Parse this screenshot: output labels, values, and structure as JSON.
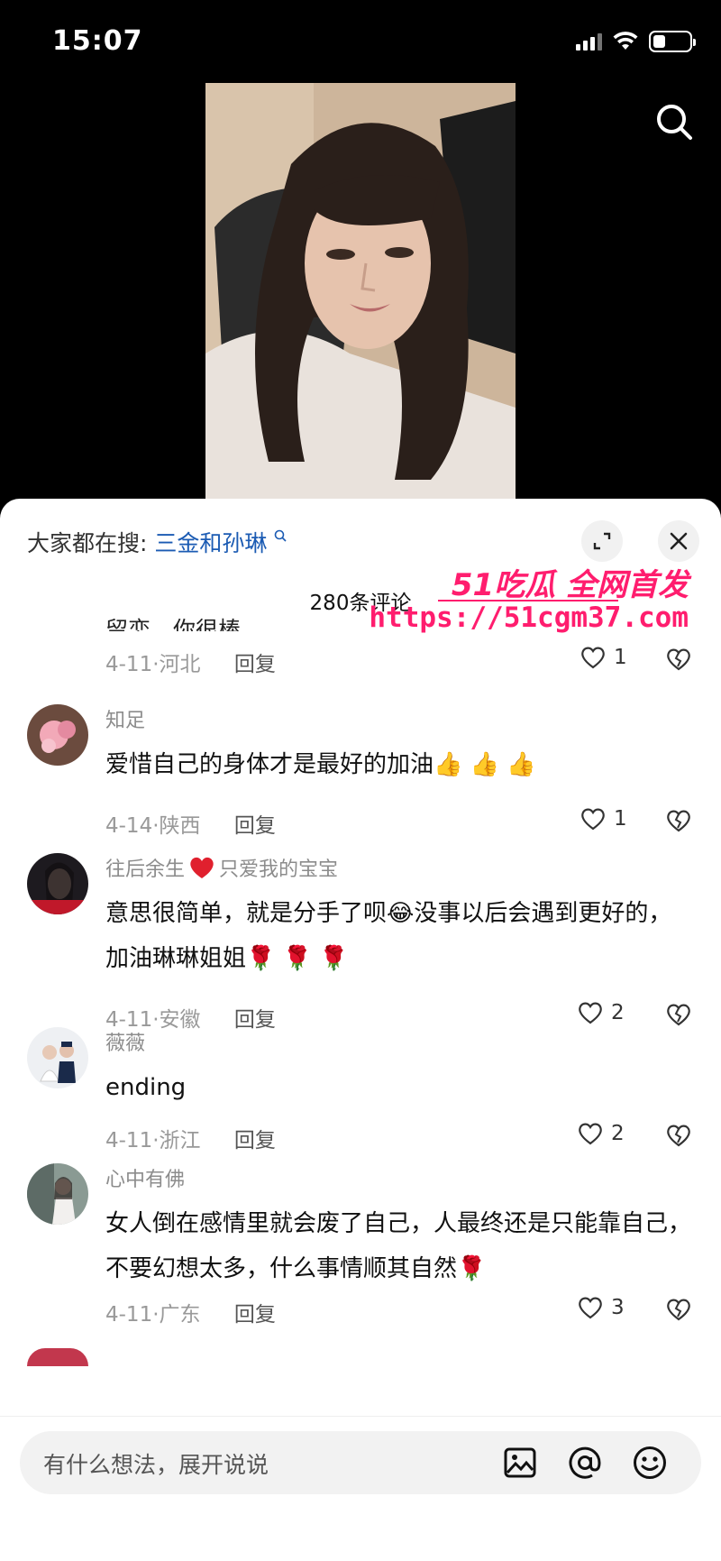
{
  "status": {
    "time": "15:07"
  },
  "sheet": {
    "trending_prefix": "大家都在搜:",
    "trending_term": "三金和孙琳",
    "comment_count": "280条评论"
  },
  "watermark": {
    "title": "51吃瓜 全网首发",
    "url": "https://51cgm37.com"
  },
  "partial_comment": {
    "text": "留恋，你很棒",
    "date": "4-11",
    "location": "河北",
    "reply": "回复",
    "likes": "1"
  },
  "comments": [
    {
      "username": "知足",
      "text": "爱惜自己的身体才是最好的加油👍 👍 👍",
      "date": "4-14",
      "location": "陕西",
      "reply": "回复",
      "likes": "1"
    },
    {
      "username": "往后余生",
      "username_suffix": "只爱我的宝宝",
      "text": "意思很简单，就是分手了呗😂没事以后会遇到更好的，加油琳琳姐姐🌹 🌹 🌹",
      "date": "4-11",
      "location": "安徽",
      "reply": "回复",
      "likes": "2"
    },
    {
      "username": "薇薇",
      "text": "ending",
      "date": "4-11",
      "location": "浙江",
      "reply": "回复",
      "likes": "2"
    },
    {
      "username": "心中有佛",
      "text": "女人倒在感情里就会废了自己，人最终还是只能靠自己，不要幻想太多，什么事情顺其自然🌹",
      "date": "4-11",
      "location": "广东",
      "reply": "回复",
      "likes": "3"
    }
  ],
  "input": {
    "placeholder": "有什么想法，展开说说"
  }
}
